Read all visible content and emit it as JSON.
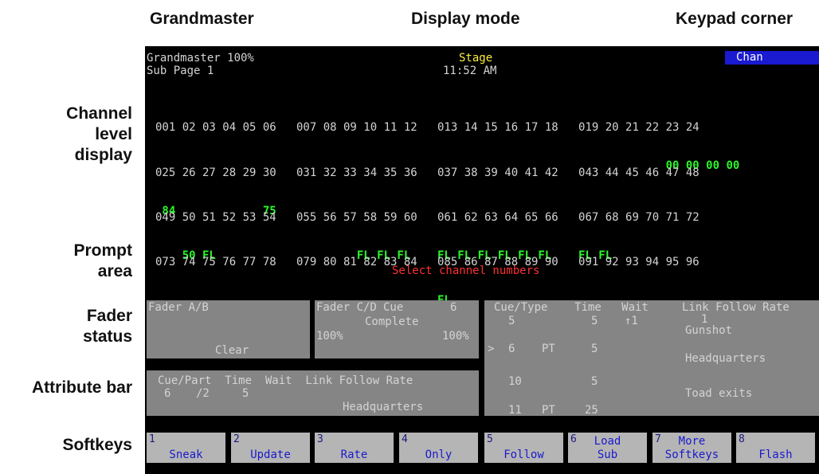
{
  "headers": {
    "grandmaster": "Grandmaster",
    "display_mode": "Display mode",
    "keypad_corner": "Keypad corner"
  },
  "labels": {
    "channel_level_display": "Channel\nlevel\ndisplay",
    "prompt_area": "Prompt\narea",
    "fader_status": "Fader\nstatus",
    "attribute_bar": "Attribute bar",
    "softkeys": "Softkeys"
  },
  "screen": {
    "grandmaster": "Grandmaster 100%",
    "sub_page": "Sub Page 1",
    "mode": "Stage",
    "time": "11:52 AM",
    "keypad_mode": "Chan",
    "channel_rows": [
      {
        "chans": "001 02 03 04 05 06   007 08 09 10 11 12   013 14 15 16 17 18   019 20 21 22 23 24",
        "levels": "                                                                            00 00 00 00"
      },
      {
        "chans": "025 26 27 28 29 30   031 32 33 34 35 36   037 38 39 40 41 42   043 44 45 46 47 48",
        "levels": " 84             75"
      },
      {
        "chans": "049 50 51 52 53 54   055 56 57 58 59 60   061 62 63 64 65 66   067 68 69 70 71 72",
        "levels": "    50 FL                     FL FL FL    FL FL FL FL FL FL    FL FL"
      },
      {
        "chans": "073 74 75 76 77 78   079 80 81 82 83 84   085 86 87 88 89 90   091 92 93 94 95 96",
        "levels": "                                          FL"
      }
    ],
    "prompt": "Select channel numbers",
    "fader_ab": {
      "title": "Fader A/B",
      "status": "Clear"
    },
    "fader_cd": {
      "title": "Fader C/D",
      "cue_label": "Cue",
      "cue_value": "6",
      "status": "Complete",
      "left_pct": "100%",
      "right_pct": "100%"
    },
    "attribute_bar": {
      "headers": "Cue/Part  Time  Wait  Link Follow Rate",
      "cue": "6",
      "part": "/2",
      "time": "5",
      "label": "Headquarters"
    },
    "cue_list": {
      "headers": "Cue/Type    Time   Wait     Link Follow Rate",
      "rows": [
        {
          "cue": "5",
          "type": "",
          "time": "5",
          "wait": "↑1",
          "detail": "1",
          "detail2": "Gunshot"
        },
        {
          "marker": ">",
          "cue": "6",
          "type": "PT",
          "time": "5",
          "wait": "",
          "detail": "Headquarters"
        },
        {
          "cue": "10",
          "type": "",
          "time": "5",
          "wait": "",
          "detail": "Toad exits"
        },
        {
          "cue": "11",
          "type": "PT",
          "time": "25",
          "wait": "",
          "detail": ""
        }
      ]
    },
    "softkeys": [
      {
        "n": "1",
        "label": "Sneak",
        "label2": ""
      },
      {
        "n": "2",
        "label": "Update",
        "label2": ""
      },
      {
        "n": "3",
        "label": "Rate",
        "label2": ""
      },
      {
        "n": "4",
        "label": "Only",
        "label2": ""
      },
      {
        "n": "5",
        "label": "Follow",
        "label2": ""
      },
      {
        "n": "6",
        "label": "Load",
        "label2": "Sub"
      },
      {
        "n": "7",
        "label": "More",
        "label2": "Softkeys"
      },
      {
        "n": "8",
        "label": "Flash",
        "label2": ""
      }
    ]
  }
}
